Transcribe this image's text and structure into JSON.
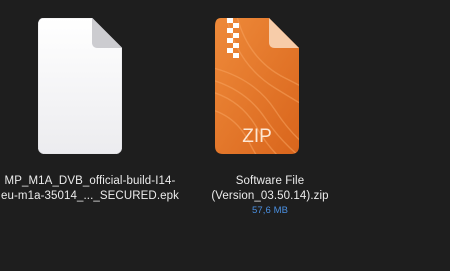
{
  "files": [
    {
      "name_line1": "MP_M1A_DVB_official-build-I14-",
      "name_line2": "eu-m1a-35014_..._SECURED.epk",
      "icon": "generic-document-icon",
      "color": "#f2f2f4"
    },
    {
      "name_line1": "Software File",
      "name_line2": "(Version_03.50.14).zip",
      "size": "57,6 MB",
      "icon": "zip-archive-icon",
      "icon_label": "ZIP",
      "color": "#e3772b"
    }
  ],
  "colors": {
    "background": "#1e1e1e",
    "filename_text": "#ececec",
    "size_text": "#4a90e2"
  }
}
